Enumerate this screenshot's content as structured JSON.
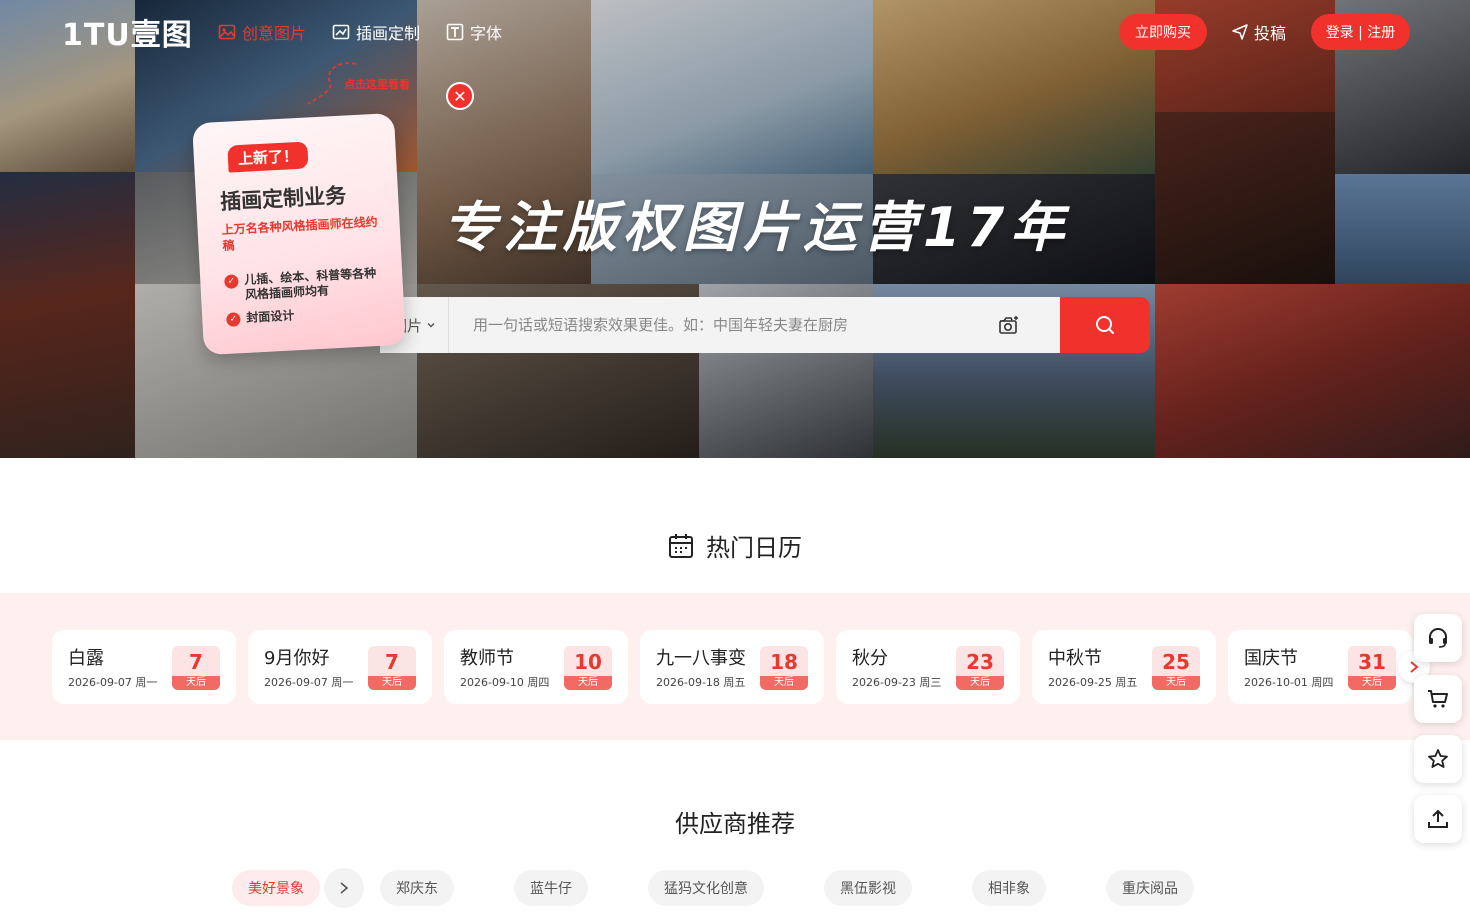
{
  "header": {
    "logo": "1TU壹图",
    "nav": [
      {
        "label": "创意图片",
        "icon": "image-icon",
        "active": true
      },
      {
        "label": "插画定制",
        "icon": "illustration-icon",
        "active": false
      },
      {
        "label": "字体",
        "icon": "font-icon",
        "active": false
      }
    ],
    "buy_label": "立即购买",
    "submit_label": "投稿",
    "login_label": "登录 | 注册"
  },
  "hero": {
    "title": "专注版权图片运营17年",
    "search": {
      "type_label": "图片",
      "placeholder": "用一句话或短语搜索效果更佳。如：中国年轻夫妻在厨房"
    }
  },
  "promo": {
    "tag": "上新了！",
    "title": "插画定制业务",
    "subtitle": "上万名各种风格插画师在线约稿",
    "items": [
      "儿插、绘本、科普等各种风格插画师均有",
      "封面设计"
    ],
    "hint": "点击这里看看"
  },
  "calendar": {
    "heading": "热门日历",
    "items": [
      {
        "name": "白露",
        "date": "2026-09-07 周一",
        "days": "7",
        "unit": "天后"
      },
      {
        "name": "9月你好",
        "date": "2026-09-07 周一",
        "days": "7",
        "unit": "天后"
      },
      {
        "name": "教师节",
        "date": "2026-09-10 周四",
        "days": "10",
        "unit": "天后"
      },
      {
        "name": "九一八事变",
        "date": "2026-09-18 周五",
        "days": "18",
        "unit": "天后"
      },
      {
        "name": "秋分",
        "date": "2026-09-23 周三",
        "days": "23",
        "unit": "天后"
      },
      {
        "name": "中秋节",
        "date": "2026-09-25 周五",
        "days": "25",
        "unit": "天后"
      },
      {
        "name": "国庆节",
        "date": "2026-10-01 周四",
        "days": "31",
        "unit": "天后"
      }
    ]
  },
  "suppliers": {
    "heading": "供应商推荐",
    "tabs": [
      "美好景象",
      "郑庆东",
      "蓝牛仔",
      "猛犸文化创意",
      "黑伍影视",
      "相非象",
      "重庆阅品"
    ]
  },
  "colors": {
    "accent": "#f1322c",
    "calendar_band": "#fdf0ef"
  }
}
